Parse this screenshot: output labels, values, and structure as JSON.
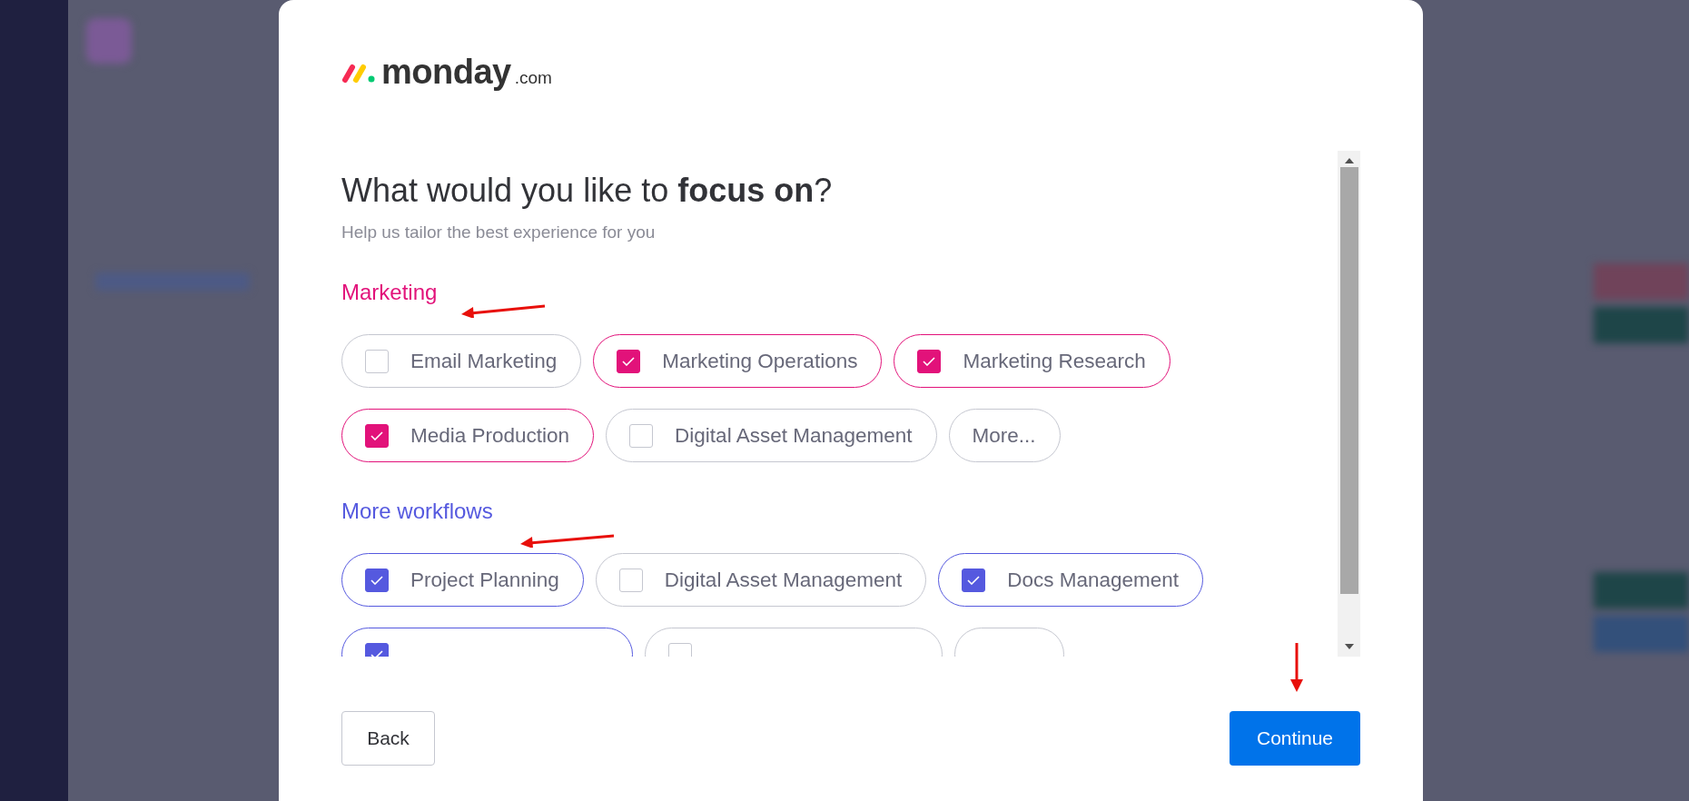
{
  "logo": {
    "name": "monday",
    "suffix": ".com"
  },
  "heading": "What would you like to **focus on**?",
  "subtitle": "Help us tailor the best experience for you",
  "sections": [
    {
      "title": "Marketing",
      "color": "#e2127a",
      "options": [
        {
          "kind": "option",
          "label": "Email Marketing",
          "checked": false
        },
        {
          "kind": "option",
          "label": "Marketing Operations",
          "checked": true
        },
        {
          "kind": "option",
          "label": "Marketing Research",
          "checked": true
        },
        {
          "kind": "option",
          "label": "Media Production",
          "checked": true
        },
        {
          "kind": "option",
          "label": "Digital Asset Management",
          "checked": false
        },
        {
          "kind": "more",
          "label": "More..."
        }
      ]
    },
    {
      "title": "More workflows",
      "color": "#5559df",
      "options": [
        {
          "kind": "option",
          "label": "Project Planning",
          "checked": true
        },
        {
          "kind": "option",
          "label": "Digital Asset Management",
          "checked": false
        },
        {
          "kind": "option",
          "label": "Docs Management",
          "checked": true
        },
        {
          "kind": "option",
          "checked": true
        },
        {
          "kind": "option",
          "checked": false
        },
        {
          "kind": "more"
        }
      ]
    }
  ],
  "buttons": {
    "back": "Back",
    "continue": "Continue"
  }
}
